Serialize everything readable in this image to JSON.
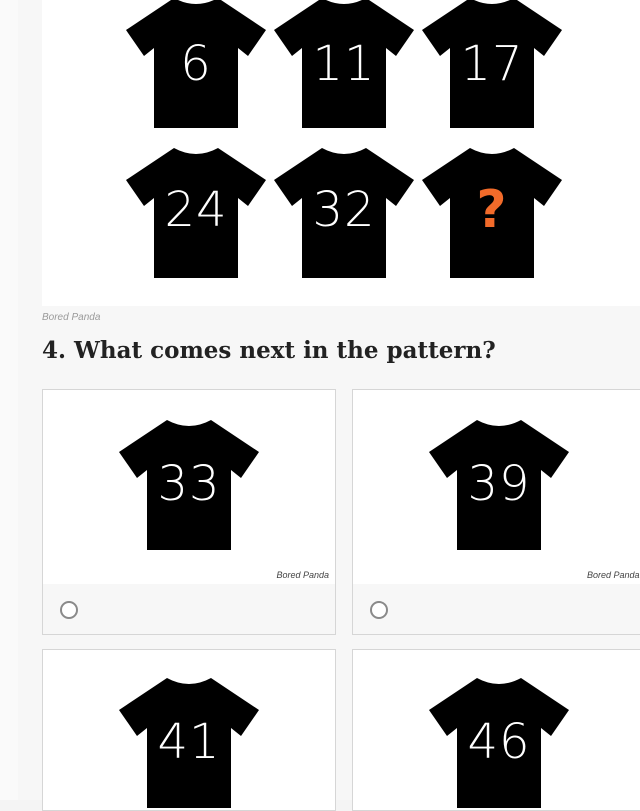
{
  "puzzle": {
    "shirts": [
      {
        "number": "6",
        "highlight": false
      },
      {
        "number": "11",
        "highlight": false
      },
      {
        "number": "17",
        "highlight": false
      },
      {
        "number": "24",
        "highlight": false
      },
      {
        "number": "32",
        "highlight": false
      },
      {
        "number": "?",
        "highlight": true
      }
    ],
    "credit": "Bored Panda"
  },
  "question": {
    "title": "4. What comes next in the pattern?"
  },
  "answers": [
    {
      "number": "33",
      "credit": "Bored Panda"
    },
    {
      "number": "39",
      "credit": "Bored Panda"
    },
    {
      "number": "41",
      "credit": ""
    },
    {
      "number": "46",
      "credit": ""
    }
  ],
  "colors": {
    "shirt": "#000000",
    "highlight": "#f26b2a",
    "shirt_text": "#ffffff"
  },
  "icons": {
    "shirt": "tshirt-icon",
    "radio": "radio-button-icon"
  }
}
